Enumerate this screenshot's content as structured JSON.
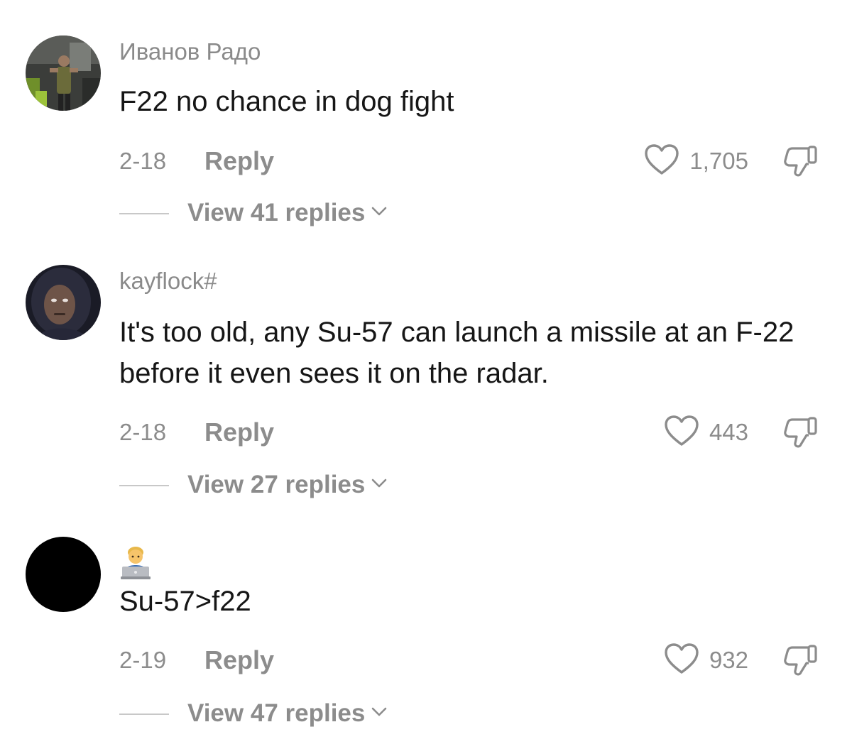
{
  "comments": [
    {
      "username": "Иванов Радо",
      "text": "F22 no chance in dog fight",
      "date": "2-18",
      "reply_label": "Reply",
      "likes": "1,705",
      "view_replies": "View 41 replies"
    },
    {
      "username": "kayflock#",
      "text": "It's too old, any Su-57 can launch a missile at an F-22 before it even sees it on the radar.",
      "date": "2-18",
      "reply_label": "Reply",
      "likes": "443",
      "view_replies": "View 27 replies"
    },
    {
      "username_icon": "technologist-emoji-icon",
      "text": "Su-57>f22",
      "date": "2-19",
      "reply_label": "Reply",
      "likes": "932",
      "view_replies": "View 47 replies"
    }
  ],
  "icons": {
    "like": "heart-outline-icon",
    "dislike": "thumbs-down-outline-icon",
    "expand": "chevron-down-icon"
  },
  "colors": {
    "text_primary": "#161616",
    "text_secondary": "#8c8c8c"
  }
}
